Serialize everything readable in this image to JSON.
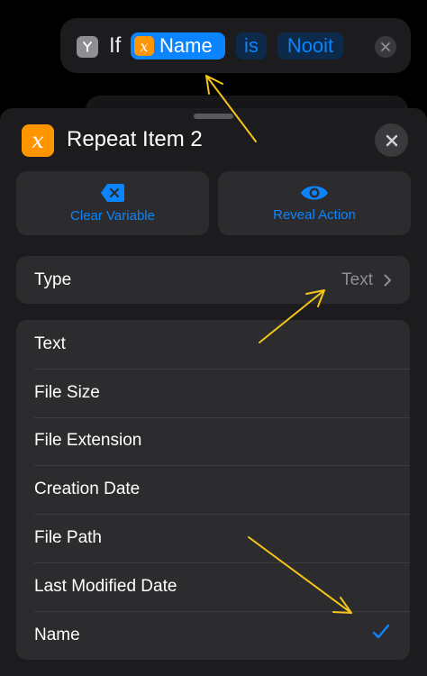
{
  "if_action": {
    "keyword": "If",
    "variable_glyph": "x",
    "variable": "Name",
    "operator": "is",
    "value": "Nooit"
  },
  "sheet": {
    "icon_glyph": "x",
    "title": "Repeat Item 2",
    "buttons": [
      {
        "label": "Clear Variable",
        "icon": "clear-icon"
      },
      {
        "label": "Reveal Action",
        "icon": "eye-icon"
      }
    ],
    "type_row": {
      "label": "Type",
      "value": "Text"
    },
    "options": [
      {
        "label": "Text",
        "selected": false
      },
      {
        "label": "File Size",
        "selected": false
      },
      {
        "label": "File Extension",
        "selected": false
      },
      {
        "label": "Creation Date",
        "selected": false
      },
      {
        "label": "File Path",
        "selected": false
      },
      {
        "label": "Last Modified Date",
        "selected": false
      },
      {
        "label": "Name",
        "selected": true
      }
    ]
  },
  "colors": {
    "accent": "#0a84ff",
    "variable_icon": "#ff9500",
    "annotation_arrow": "#f5c518",
    "sheet_background": "#1c1c1e",
    "row_background": "#2c2c2e"
  }
}
